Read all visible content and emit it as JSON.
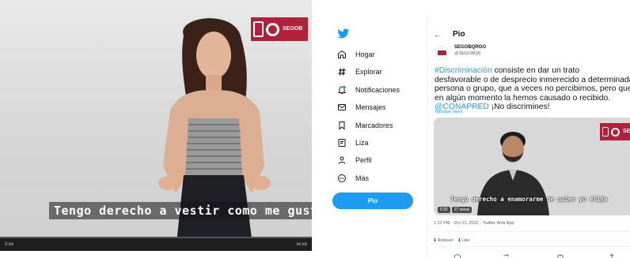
{
  "left_video": {
    "caption": "Tengo derecho a vestir como me gusta",
    "logo_text": "SEGOB",
    "player_left": "0:xx",
    "player_right": "xx:xx"
  },
  "twitter": {
    "nav": {
      "items": [
        {
          "label": "Hogar",
          "icon": "home-icon"
        },
        {
          "label": "Explorar",
          "icon": "hashtag-icon"
        },
        {
          "label": "Notificaciones",
          "icon": "bell-icon"
        },
        {
          "label": "Mensajes",
          "icon": "mail-icon"
        },
        {
          "label": "Marcadores",
          "icon": "bookmark-icon"
        },
        {
          "label": "Liza",
          "icon": "list-icon"
        },
        {
          "label": "Perfil",
          "icon": "person-icon"
        },
        {
          "label": "Más",
          "icon": "more-icon"
        }
      ],
      "tweet_button": "Pio"
    },
    "header": {
      "title": "Pio"
    },
    "account": {
      "name": "SEGOBQROO",
      "handle": "@SEGOBQR"
    },
    "tweet": {
      "hashtag": "#Discriminación",
      "line1_rest": " consiste en dar un trato",
      "line2": "desfavorable o de desprecio inmerecido a determinada",
      "line3": "persona o grupo, que a veces no percibimos, pero que",
      "line4": "en algún momento la hemos causado o recibido.",
      "mention": "@CONAPRED",
      "line5_rest": " ¡No discrimines!",
      "translate": "Translate Tweet"
    },
    "video": {
      "caption": "Tengo derecho a enamorarme de quien yo elija",
      "logo_text": "SEGOB",
      "duration": "0:25",
      "views": "27 views"
    },
    "timestamp": "1:22 PM · Oct 21, 2022 · Twitter Web App",
    "stats": {
      "retweets": "1",
      "retweets_label": "Retweet",
      "likes": "1",
      "likes_label": "Like"
    },
    "colors": {
      "accent": "#1d9bf0",
      "brand_red": "#b0213a"
    }
  }
}
